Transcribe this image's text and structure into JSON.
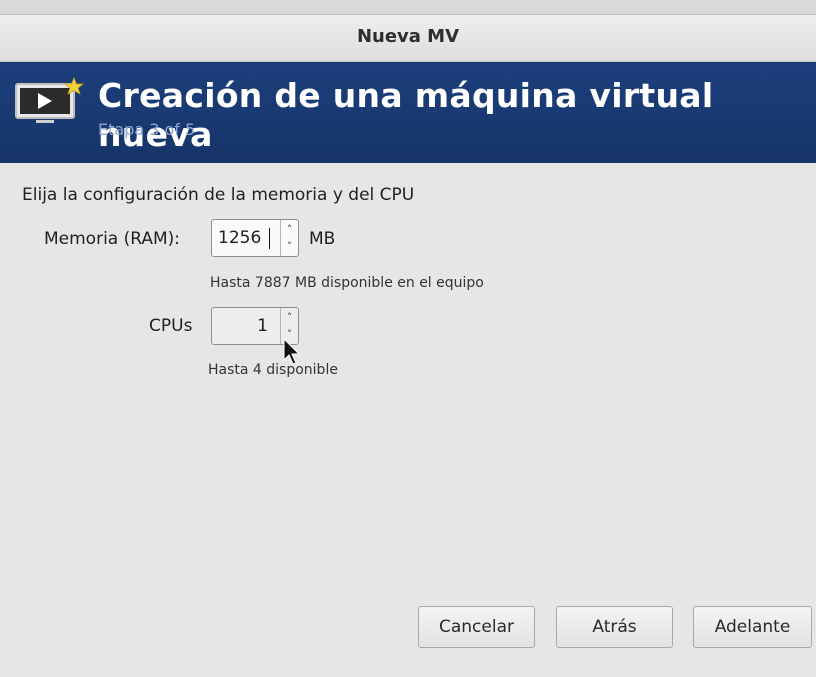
{
  "window": {
    "title": "Nueva MV"
  },
  "header": {
    "heading": "Creación de una máquina virtual nueva",
    "step": "Etapa 3 of 5",
    "icon": "vm-monitor-icon"
  },
  "instruction": "Elija la configuración de la memoria y del CPU",
  "memory": {
    "label": "Memoria (RAM):",
    "value": "1256",
    "unit": "MB",
    "hint": "Hasta 7887 MB disponible en el equipo"
  },
  "cpus": {
    "label": "CPUs",
    "value": "1",
    "hint": "Hasta 4 disponible"
  },
  "buttons": {
    "cancel": "Cancelar",
    "back": "Atrás",
    "forward": "Adelante"
  },
  "colors": {
    "header_bg": "#1a3a74",
    "step_text": "#8fa6cf",
    "window_bg": "#e6e6e4"
  }
}
